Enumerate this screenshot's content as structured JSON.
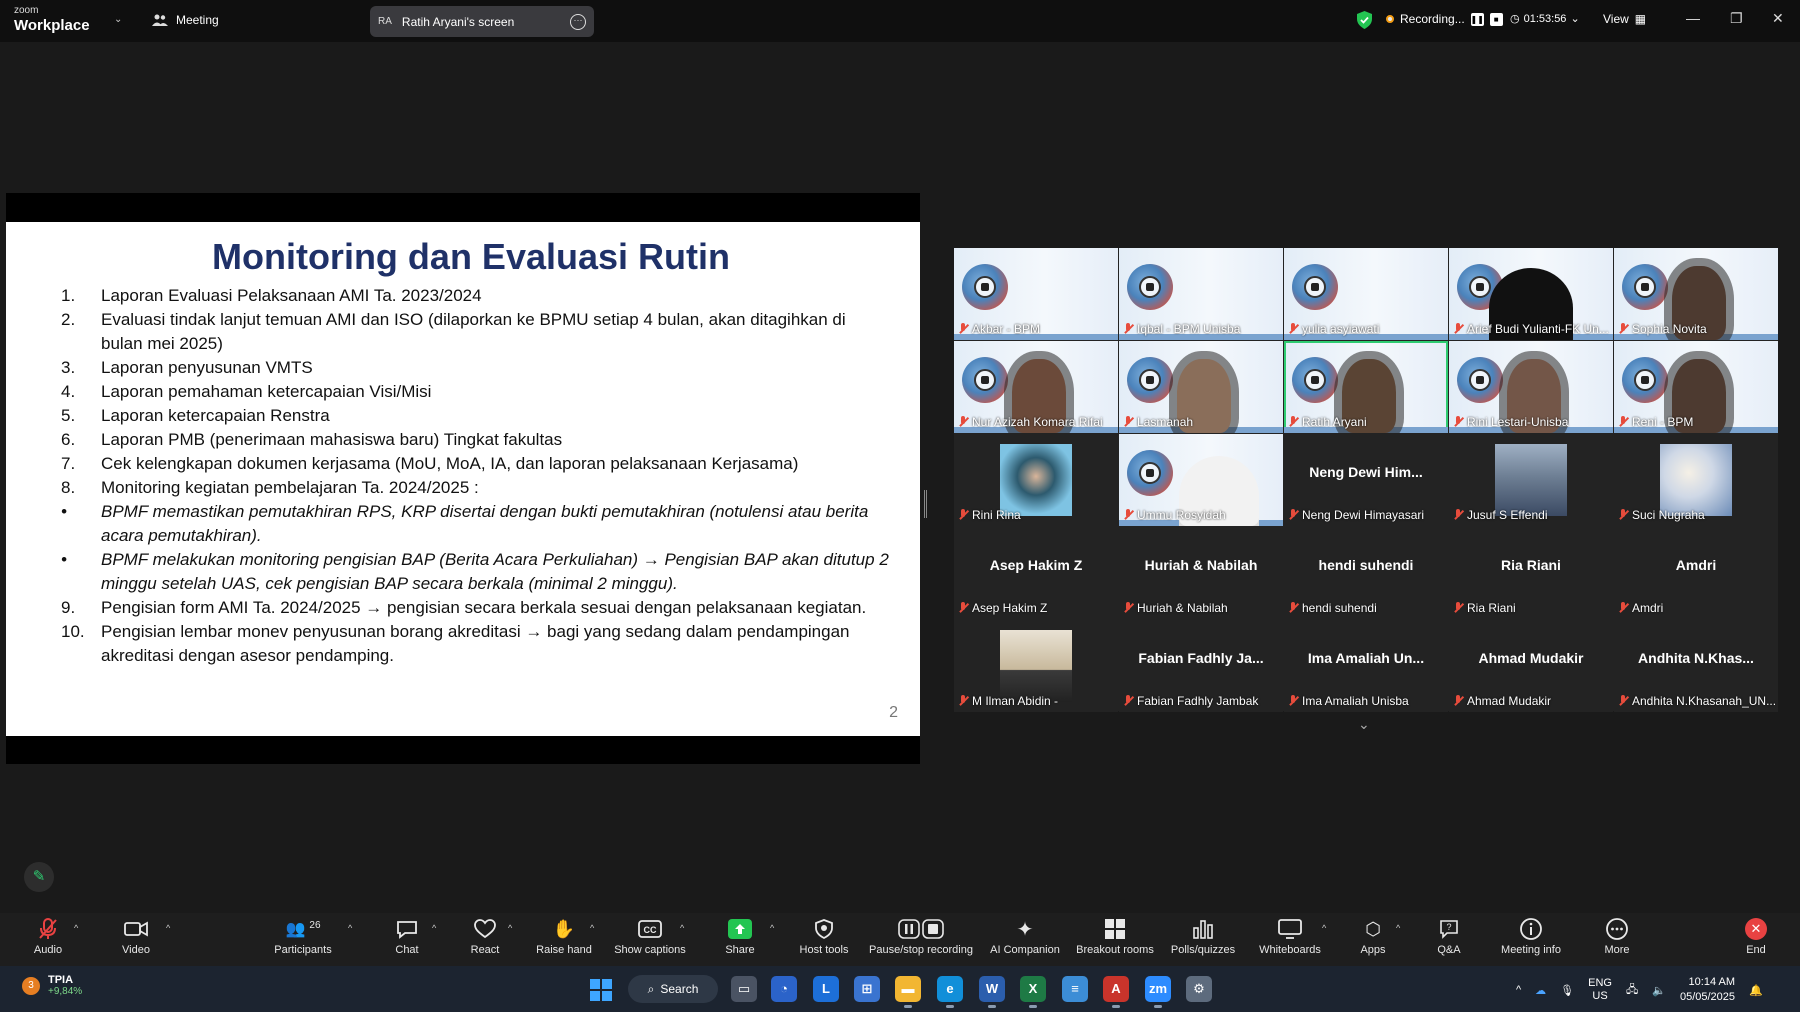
{
  "topbar": {
    "logo_top": "zoom",
    "logo_bottom": "Workplace",
    "meeting_label": "Meeting",
    "share_initials": "RA",
    "share_title": "Ratih Aryani's screen",
    "recording_label": "Recording...",
    "timer": "01:53:56",
    "view_label": "View"
  },
  "slide": {
    "title": "Monitoring dan Evaluasi Rutin",
    "page_number": "2",
    "items": [
      {
        "num": "1.",
        "text": "Laporan Evaluasi Pelaksanaan AMI Ta. 2023/2024",
        "italic": false
      },
      {
        "num": "2.",
        "text": "Evaluasi tindak lanjut temuan AMI dan ISO (dilaporkan ke BPMU setiap 4 bulan, akan ditagihkan di bulan mei 2025)",
        "italic": false
      },
      {
        "num": "3.",
        "text": "Laporan penyusunan VMTS",
        "italic": false
      },
      {
        "num": "4.",
        "text": "Laporan pemahaman ketercapaian  Visi/Misi",
        "italic": false
      },
      {
        "num": "5.",
        "text": "Laporan ketercapaian Renstra",
        "italic": false
      },
      {
        "num": "6.",
        "text": "Laporan PMB (penerimaan mahasiswa baru) Tingkat fakultas",
        "italic": false
      },
      {
        "num": "7.",
        "text": "Cek kelengkapan dokumen kerjasama (MoU, MoA, IA, dan laporan pelaksanaan Kerjasama)",
        "italic": false
      },
      {
        "num": "8.",
        "text": "Monitoring kegiatan pembelajaran Ta. 2024/2025 :",
        "italic": false
      },
      {
        "num": "•",
        "text": "BPMF memastikan pemutakhiran RPS, KRP disertai dengan bukti pemutakhiran (notulensi atau berita acara pemutakhiran).",
        "italic": true
      },
      {
        "num": "•",
        "text": "BPMF melakukan monitoring pengisian BAP (Berita Acara Perkuliahan) → Pengisian BAP akan ditutup 2 minggu setelah UAS, cek pengisian BAP secara berkala (minimal 2 minggu).",
        "italic": true
      },
      {
        "num": "9.",
        "text": "Pengisian form AMI Ta. 2024/2025 → pengisian secara berkala sesuai dengan pelaksanaan kegiatan.",
        "italic": false
      },
      {
        "num": "10.",
        "text": "Pengisian lembar monev penyusunan borang akreditasi → bagi yang sedang dalam pendampingan akreditasi dengan asesor pendamping.",
        "italic": false
      }
    ]
  },
  "gallery": {
    "tiles": [
      {
        "name": "Akbar - BPM",
        "kind": "bpm"
      },
      {
        "name": "Iqbal - BPM Unisba",
        "kind": "bpm"
      },
      {
        "name": "yulia asyiawati",
        "kind": "bpm"
      },
      {
        "name": "Arief Budi Yulianti-FK Un...",
        "kind": "bpm-dark"
      },
      {
        "name": "Sophia Novita",
        "kind": "bpm-face"
      },
      {
        "name": "Nur Azizah Komara Rifai",
        "kind": "bpm-face"
      },
      {
        "name": "Lasmanah",
        "kind": "bpm-face"
      },
      {
        "name": "Ratih Aryani",
        "kind": "bpm-face-active"
      },
      {
        "name": "Rini Lestari-Unisba",
        "kind": "bpm-face"
      },
      {
        "name": "Reni - BPM",
        "kind": "bpm-face"
      },
      {
        "name": "Rini Rina",
        "kind": "photo"
      },
      {
        "name": "Ummu Rosyidah",
        "kind": "bpm-hijab"
      },
      {
        "name": "Neng Dewi Himayasari",
        "kind": "text",
        "display": "Neng Dewi Him..."
      },
      {
        "name": "Jusuf S Effendi",
        "kind": "photo"
      },
      {
        "name": "Suci Nugraha",
        "kind": "photo-flower"
      },
      {
        "name": "Asep Hakim Z",
        "kind": "text",
        "display": "Asep Hakim Z"
      },
      {
        "name": "Huriah & Nabilah",
        "kind": "text",
        "display": "Huriah & Nabilah"
      },
      {
        "name": "hendi suhendi",
        "kind": "text",
        "display": "hendi suhendi"
      },
      {
        "name": "Ria Riani",
        "kind": "text",
        "display": "Ria Riani"
      },
      {
        "name": "Amdri",
        "kind": "text",
        "display": "Amdri"
      },
      {
        "name": "M Ilman Abidin -",
        "kind": "photo-room"
      },
      {
        "name": "Fabian Fadhly Jambak",
        "kind": "text",
        "display": "Fabian Fadhly Ja..."
      },
      {
        "name": "Ima Amaliah Unisba",
        "kind": "text",
        "display": "Ima Amaliah Un..."
      },
      {
        "name": "Ahmad Mudakir",
        "kind": "text",
        "display": "Ahmad Mudakir"
      },
      {
        "name": "Andhita N.Khasanah_UN...",
        "kind": "text",
        "display": "Andhita N.Khas..."
      }
    ]
  },
  "toolbar": {
    "audio": "Audio",
    "video": "Video",
    "participants": "Participants",
    "participants_count": "26",
    "chat": "Chat",
    "react": "React",
    "raise_hand": "Raise hand",
    "captions": "Show captions",
    "share": "Share",
    "host_tools": "Host tools",
    "pause_stop": "Pause/stop recording",
    "ai_companion": "AI Companion",
    "breakout": "Breakout rooms",
    "polls": "Polls/quizzes",
    "whiteboards": "Whiteboards",
    "apps": "Apps",
    "qa": "Q&A",
    "meeting_info": "Meeting info",
    "more": "More",
    "end": "End"
  },
  "taskbar": {
    "stock_badge": "3",
    "stock_name": "TPIA",
    "stock_change": "+9,84%",
    "search": "Search",
    "lang_1": "ENG",
    "lang_2": "US",
    "time": "10:14 AM",
    "date": "05/05/2025"
  }
}
